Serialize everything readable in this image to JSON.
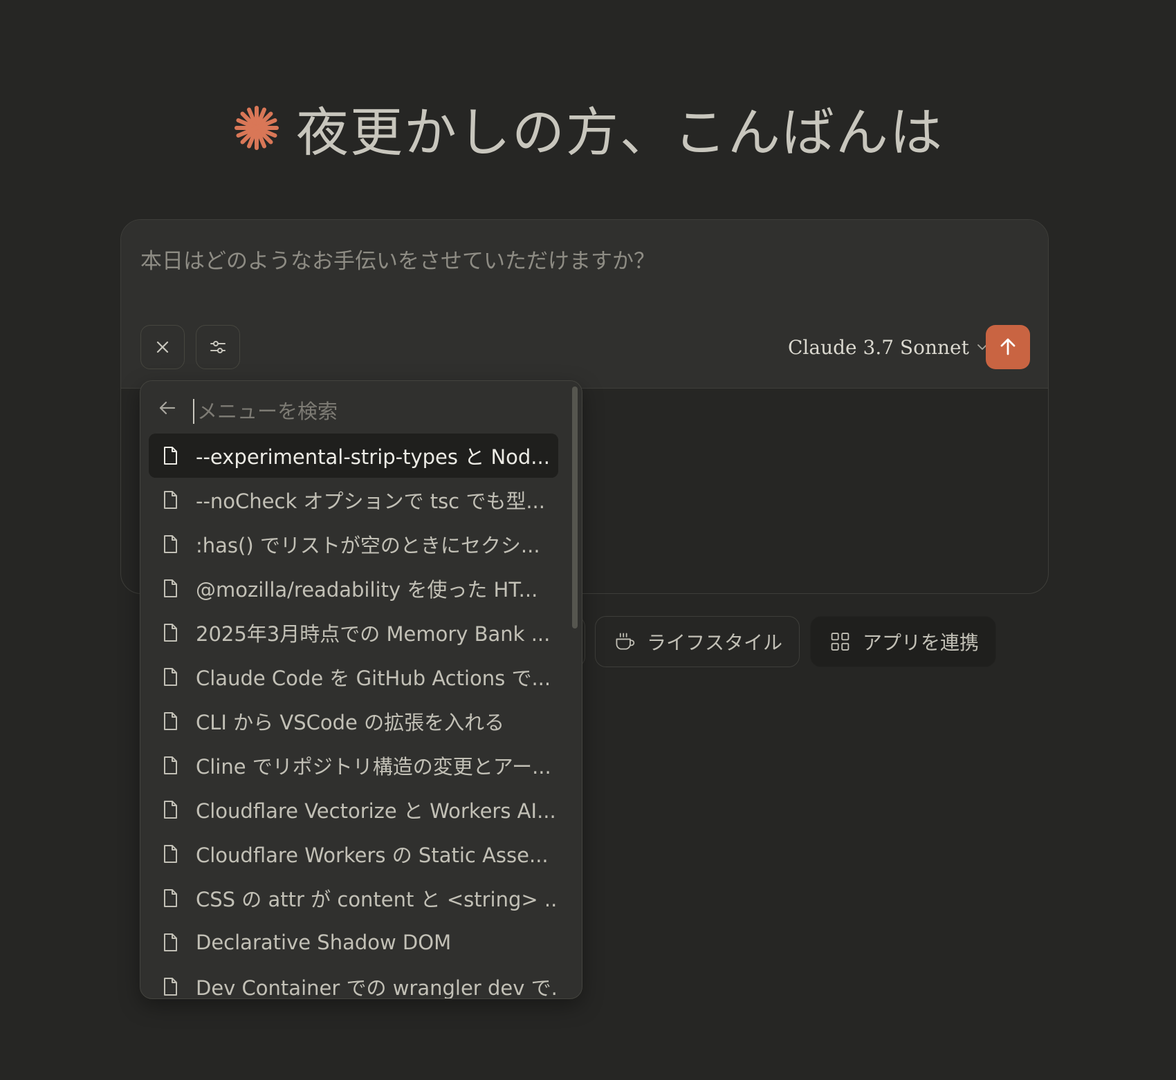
{
  "greeting": {
    "text": "夜更かしの方、こんばんは"
  },
  "composer": {
    "placeholder": "本日はどのようなお手伝いをさせていただけますか？",
    "model_label": "Claude 3.7 Sonnet",
    "icons": {
      "close": "close-icon",
      "filter": "sliders-icon",
      "model_chevron": "chevron-down-icon",
      "send": "arrow-up-icon"
    }
  },
  "menu": {
    "search_placeholder": "メニューを検索",
    "items": [
      "--experimental-strip-types と Nod...",
      "--noCheck オプションで tsc でも型...",
      ":has() でリストが空のときにセクシ...",
      "@mozilla/readability を使った HT...",
      "2025年3月時点での Memory Bank ...",
      "Claude Code を GitHub Actions で...",
      "CLI から VSCode の拡張を入れる",
      "Cline でリポジトリ構造の変更とアー...",
      "Cloudflare Vectorize と Workers AI...",
      "Cloudflare Workers の Static Asse...",
      "CSS の attr が content と <string> ...",
      "Declarative Shadow DOM",
      "Dev Container での wrangler dev で..."
    ]
  },
  "chips": {
    "lifestyle": "ライフスタイル",
    "apps": "アプリを連携"
  },
  "colors": {
    "background": "#262624",
    "accent": "#c96442",
    "card": "#30302e"
  }
}
